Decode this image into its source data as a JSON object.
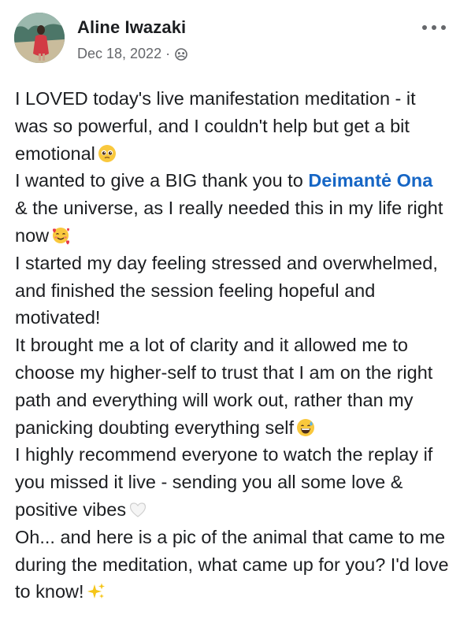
{
  "author": {
    "name": "Aline Iwazaki",
    "date": "Dec 18, 2022",
    "separator": "·"
  },
  "icons": {
    "audience": "group-audience-icon",
    "more": "more-options-icon"
  },
  "post": {
    "p1": "I LOVED today's live manifestation meditation - it was so powerful, and I couldn't help but get a bit emotional",
    "p2_before": "I wanted to give a BIG thank you to ",
    "p2_mention": "Deimantė Ona",
    "p2_after": " & the universe, as I really needed this in my life right now",
    "p3": "I started my day feeling stressed and overwhelmed, and finished the session feeling hopeful and motivated!",
    "p4": "It brought me a lot of clarity and it allowed me to choose my higher-self to trust that I am on the right path and everything will work out, rather than my panicking doubting everything self",
    "p5": "I highly recommend everyone to watch the replay if you missed it live - sending you all some love & positive vibes",
    "p6": "Oh... and here is a pic of the animal that came to me during the meditation, what came up for you? I'd love to know!"
  },
  "colors": {
    "text": "#1c1e21",
    "meta": "#65676b",
    "mention": "#1666c5"
  }
}
